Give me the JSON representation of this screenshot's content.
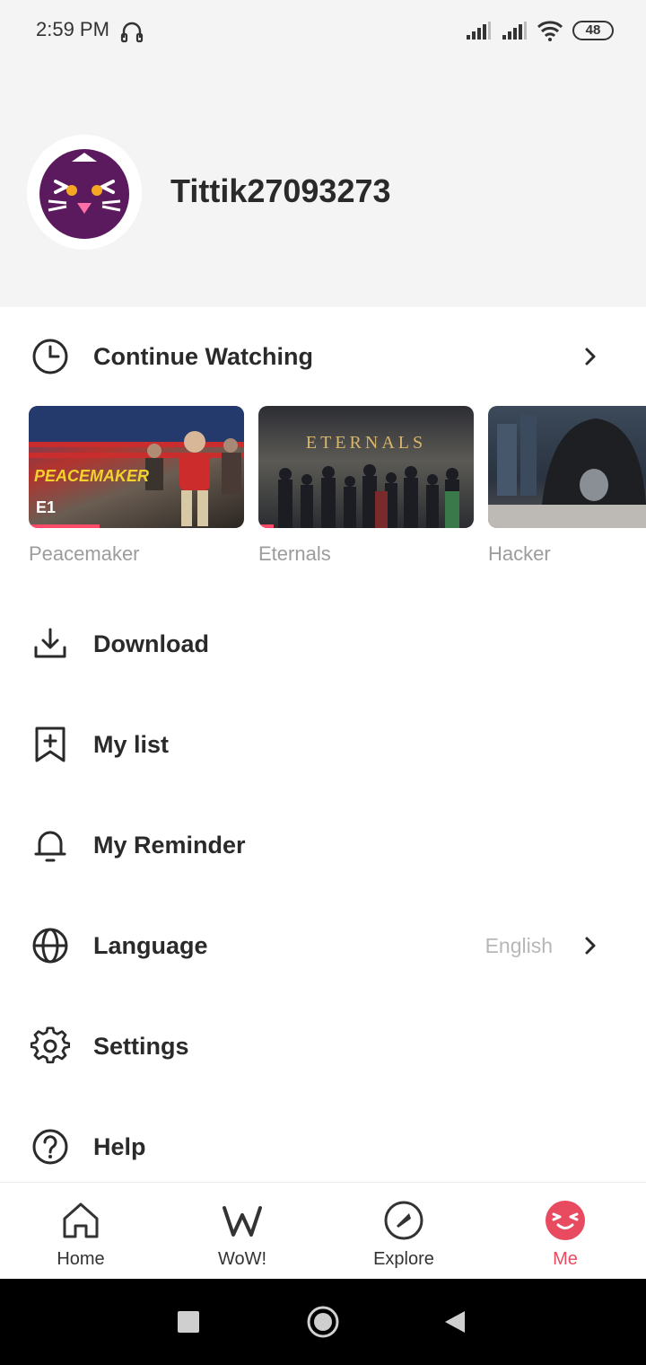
{
  "status_bar": {
    "time": "2:59 PM",
    "battery": "48",
    "icons": [
      "headset-icon",
      "signal-icon",
      "signal-icon",
      "wifi-icon",
      "battery-icon"
    ]
  },
  "profile": {
    "username": "Tittik27093273",
    "avatar_icon": "cat-avatar-icon",
    "avatar_color": "#5b1a5e"
  },
  "continue_watching": {
    "label": "Continue Watching",
    "icon": "clock-icon",
    "items": [
      {
        "title": "Peacemaker",
        "episode": "E1",
        "image_text": "PEACEMAKER",
        "progress": 0.33
      },
      {
        "title": "Eternals",
        "image_text": "ETERNALS",
        "progress": 0.07
      },
      {
        "title": "Hacker",
        "progress": 0.0
      }
    ]
  },
  "menu": {
    "download": "Download",
    "my_list": "My list",
    "my_reminder": "My Reminder",
    "language": "Language",
    "language_value": "English",
    "settings": "Settings",
    "help": "Help"
  },
  "bottom_nav": {
    "home": "Home",
    "wow": "WoW!",
    "explore": "Explore",
    "me": "Me",
    "active": "me",
    "accent_color": "#e84a5f"
  }
}
